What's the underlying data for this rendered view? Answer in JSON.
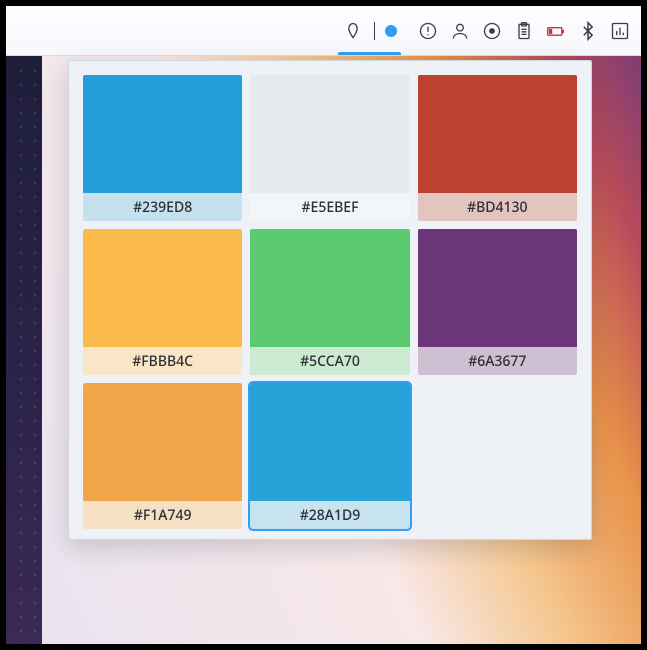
{
  "topbar": {
    "active_app": {
      "picker_icon": "eyedropper-icon",
      "current_color": "#2e9ff3"
    },
    "tray": {
      "notifications_icon": "alert-circle-icon",
      "user_icon": "user-outline-icon",
      "notify_dot_icon": "eye-circle-icon",
      "clipboard_icon": "clipboard-icon",
      "battery_icon": "battery-low-icon",
      "bluetooth_icon": "bluetooth-icon",
      "panel_icon": "panel-meter-icon"
    }
  },
  "popup": {
    "swatches": [
      {
        "hex": "#239ED8",
        "label": "#239ED8",
        "selected": false,
        "label_bg": "#c5e1ee"
      },
      {
        "hex": "#E5EBEF",
        "label": "#E5EBEF",
        "selected": false,
        "label_bg": "#f3f6f8"
      },
      {
        "hex": "#BD4130",
        "label": "#BD4130",
        "selected": false,
        "label_bg": "#e3c4be"
      },
      {
        "hex": "#FBBB4C",
        "label": "#FBBB4C",
        "selected": false,
        "label_bg": "#f9e6c6"
      },
      {
        "hex": "#5CCA70",
        "label": "#5CCA70",
        "selected": false,
        "label_bg": "#cbead0"
      },
      {
        "hex": "#6A3677",
        "label": "#6A3677",
        "selected": false,
        "label_bg": "#cfbfd3"
      },
      {
        "hex": "#F1A749",
        "label": "#F1A749",
        "selected": false,
        "label_bg": "#f6e0c4"
      },
      {
        "hex": "#28A1D9",
        "label": "#28A1D9",
        "selected": true,
        "label_bg": "#c7e3f0"
      }
    ]
  }
}
